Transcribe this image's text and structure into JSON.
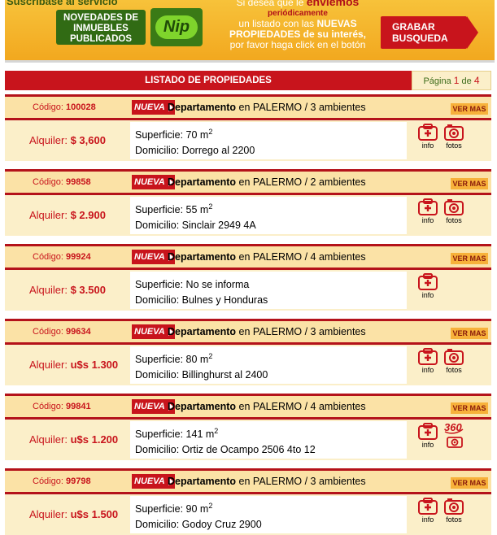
{
  "banner": {
    "subscribe_text": "Suscribase al servicio",
    "novedades_text": "NOVEDADES DE INMUEBLES PUBLICADOS",
    "nip_text": "Nip",
    "line1": "Si desea que le",
    "line1_big": "enviemos",
    "line2": "periódicamente",
    "line3": "un listado con las",
    "line3_bold": "NUEVAS",
    "line4_bold": "PROPIEDADES de su interés,",
    "line5": "por favor haga click en el botón",
    "grabar_label": "GRABAR BUSQUEDA"
  },
  "list_header": {
    "title": "LISTADO DE PROPIEDADES",
    "pagina_label": "Página",
    "current_page": "1",
    "de_label": "de",
    "total_pages": "4"
  },
  "labels": {
    "codigo": "Código:",
    "nueva": "NUEVA",
    "en": "en",
    "superficie": "Superficie:",
    "domicilio": "Domicilio:",
    "ver_mas": "VER MAS",
    "info": "info",
    "fotos": "fotos"
  },
  "colors": {
    "brand_red": "#c8141c",
    "banner_orange": "#f2a81f",
    "band_light": "#fbe2a6",
    "band_pale": "#fbefc9"
  },
  "listings": [
    {
      "codigo": "100028",
      "tipo": "Departamento",
      "zona": "PALERMO / 3 ambientes",
      "precio_label": "Alquiler:",
      "precio": "$ 3,600",
      "superficie": "70 m",
      "sup_unit": "2",
      "domicilio": "Dorrego al 2200",
      "icons": [
        "info",
        "fotos"
      ]
    },
    {
      "codigo": "99858",
      "tipo": "Departamento",
      "zona": "PALERMO / 2 ambientes",
      "precio_label": "Alquiler:",
      "precio": "$ 2.900",
      "superficie": "55 m",
      "sup_unit": "2",
      "domicilio": "Sinclair 2949 4A",
      "icons": [
        "info",
        "fotos"
      ]
    },
    {
      "codigo": "99924",
      "tipo": "Departamento",
      "zona": "PALERMO / 4 ambientes",
      "precio_label": "Alquiler:",
      "precio": "$ 3.500",
      "superficie": "No se informa",
      "sup_unit": "",
      "domicilio": "Bulnes y Honduras",
      "icons": [
        "info"
      ]
    },
    {
      "codigo": "99634",
      "tipo": "Departamento",
      "zona": "PALERMO / 3 ambientes",
      "precio_label": "Alquiler:",
      "precio": "u$s 1.300",
      "superficie": "80 m",
      "sup_unit": "2",
      "domicilio": "Billinghurst al 2400",
      "icons": [
        "info",
        "fotos"
      ]
    },
    {
      "codigo": "99841",
      "tipo": "Departamento",
      "zona": "PALERMO / 4 ambientes",
      "precio_label": "Alquiler:",
      "precio": "u$s 1.200",
      "superficie": "141 m",
      "sup_unit": "2",
      "domicilio": "Ortiz de Ocampo 2506 4to 12",
      "icons": [
        "info",
        "360",
        "fotos-small"
      ]
    },
    {
      "codigo": "99798",
      "tipo": "Departamento",
      "zona": "PALERMO / 3 ambientes",
      "precio_label": "Alquiler:",
      "precio": "u$s 1.500",
      "superficie": "90 m",
      "sup_unit": "2",
      "domicilio": "Godoy Cruz 2900",
      "icons": [
        "info",
        "fotos"
      ]
    }
  ]
}
